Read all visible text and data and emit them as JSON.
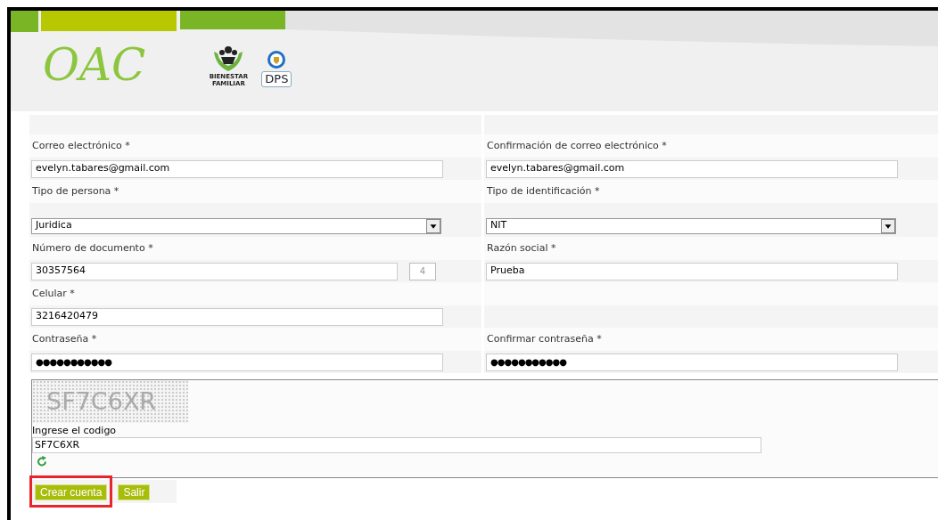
{
  "header": {
    "title": "OAC",
    "logos": [
      {
        "kind": "bienestar",
        "text": "BIENESTAR FAMILIAR"
      },
      {
        "kind": "dps",
        "text": "DPS"
      }
    ]
  },
  "form": {
    "rows": [
      {
        "left": {
          "label": "Correo electrónico *",
          "kind": "text",
          "value": "evelyn.tabares@gmail.com"
        },
        "right": {
          "label": "Confirmación de correo electrónico *",
          "kind": "text",
          "value": "evelyn.tabares@gmail.com"
        }
      },
      {
        "left": {
          "label": "Tipo de persona *",
          "kind": "select",
          "value": "Juridica"
        },
        "right": {
          "label": "Tipo de identificación *",
          "kind": "select",
          "value": "NIT"
        }
      },
      {
        "left": {
          "label": "Número de documento *",
          "kind": "text",
          "value": "30357564",
          "counter": "4"
        },
        "right": {
          "label": "Razón social *",
          "kind": "text",
          "value": "Prueba"
        }
      },
      {
        "left": {
          "label": "Celular *",
          "kind": "text",
          "value": "3216420479"
        }
      },
      {
        "left": {
          "label": "Contraseña *",
          "kind": "password",
          "value": "●●●●●●●●●●●"
        },
        "right": {
          "label": "Confirmar contraseña *",
          "kind": "password",
          "value": "●●●●●●●●●●●"
        }
      }
    ]
  },
  "captcha": {
    "image_text": "SF7C6XR",
    "label": "Ingrese el codigo",
    "value": "SF7C6XR"
  },
  "buttons": [
    {
      "label": "Crear cuenta",
      "highlighted": true
    },
    {
      "label": "Salir",
      "highlighted": false
    }
  ]
}
